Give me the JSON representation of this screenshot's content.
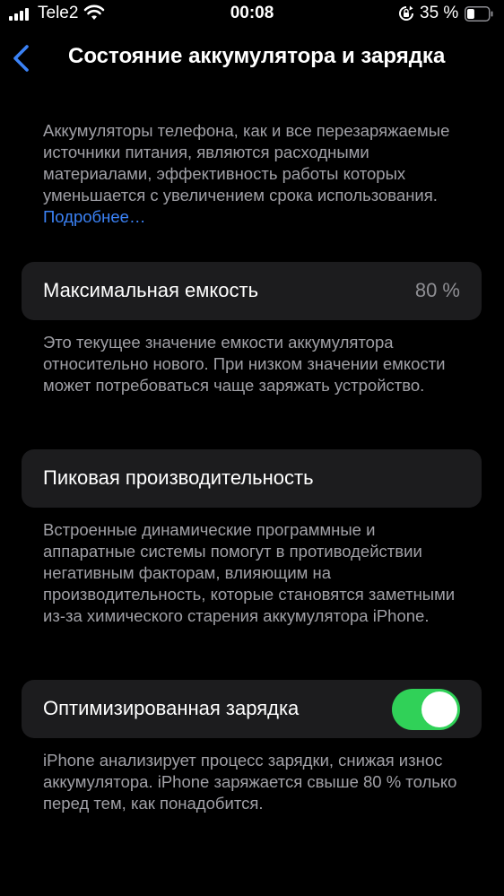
{
  "status_bar": {
    "carrier": "Tele2",
    "time": "00:08",
    "battery_percent": "35 %",
    "battery_level": 0.35,
    "signal_bars": 4
  },
  "nav": {
    "title": "Состояние аккумулятора и зарядка"
  },
  "intro": {
    "text": "Аккумуляторы телефона, как и все перезаряжаемые источники питания, являются расходными материалами, эффективность работы которых уменьшается с увеличением срока использования.",
    "link": "Подробнее…"
  },
  "max_capacity": {
    "label": "Максимальная емкость",
    "value": "80 %",
    "footer": "Это текущее значение емкости аккумулятора относительно нового. При низком значении емкости может потребоваться чаще заряжать устройство."
  },
  "peak_performance": {
    "label": "Пиковая производительность",
    "footer": "Встроенные динамические программные и аппаратные системы помогут в противодействии негативным факторам, влияющим на производительность, которые становятся заметными из-за химического старения аккумулятора iPhone."
  },
  "optimized_charging": {
    "label": "Оптимизированная зарядка",
    "enabled": true,
    "footer": "iPhone анализирует процесс зарядки, снижая износ аккумулятора. iPhone заряжается свыше 80 % только перед тем, как понадобится."
  },
  "colors": {
    "background": "#000000",
    "cell": "#1c1c1e",
    "accent_link": "#3b82f6",
    "toggle_on": "#30d158",
    "secondary_text": "#a0a0a6"
  }
}
